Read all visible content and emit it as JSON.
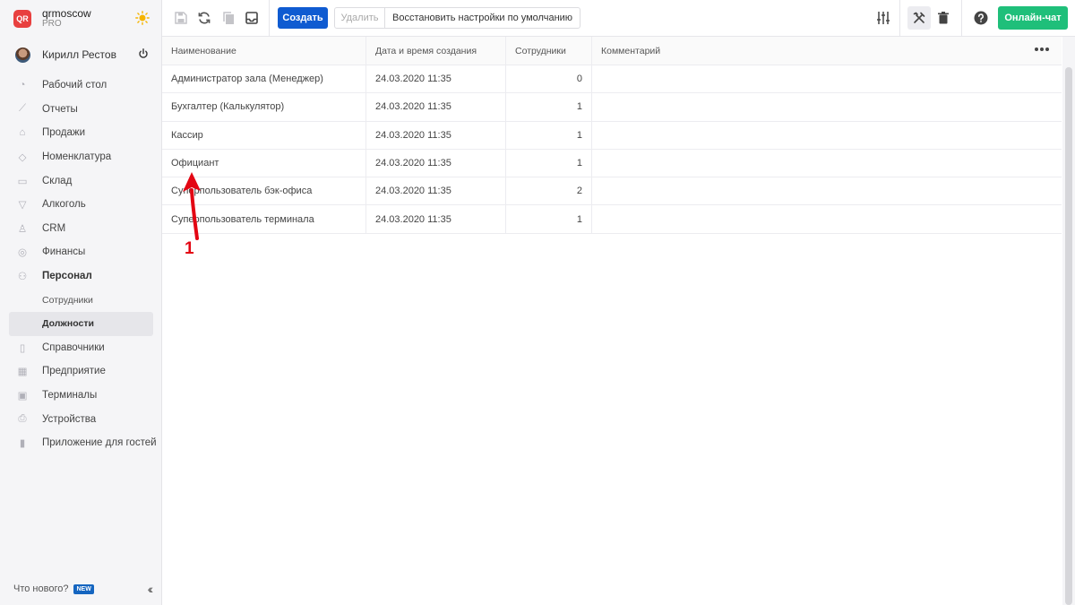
{
  "brand": {
    "logo_text": "QR",
    "name": "qrmoscow",
    "plan": "PRO"
  },
  "user": {
    "name": "Кирилл Рестов"
  },
  "nav": {
    "items": [
      {
        "label": "Рабочий стол",
        "icon": "dashboard-icon"
      },
      {
        "label": "Отчеты",
        "icon": "chart-icon"
      },
      {
        "label": "Продажи",
        "icon": "basket-icon"
      },
      {
        "label": "Номенклатура",
        "icon": "tag-icon"
      },
      {
        "label": "Склад",
        "icon": "box-icon"
      },
      {
        "label": "Алкоголь",
        "icon": "glass-icon"
      },
      {
        "label": "CRM",
        "icon": "crm-icon"
      },
      {
        "label": "Финансы",
        "icon": "coins-icon"
      },
      {
        "label": "Персонал",
        "icon": "people-icon"
      }
    ],
    "sub": [
      {
        "label": "Сотрудники"
      },
      {
        "label": "Должности"
      }
    ],
    "items2": [
      {
        "label": "Справочники",
        "icon": "book-icon"
      },
      {
        "label": "Предприятие",
        "icon": "building-icon"
      },
      {
        "label": "Терминалы",
        "icon": "terminal-icon"
      },
      {
        "label": "Устройства",
        "icon": "printer-icon"
      },
      {
        "label": "Приложение для гостей",
        "icon": "phone-icon"
      }
    ]
  },
  "footer": {
    "whats_new": "Что нового?",
    "badge": "NEW"
  },
  "toolbar": {
    "create": "Создать",
    "delete": "Удалить",
    "restore": "Восстановить настройки по умолчанию",
    "chat": "Онлайн-чат"
  },
  "table": {
    "columns": [
      "Наименование",
      "Дата и время создания",
      "Сотрудники",
      "Комментарий"
    ],
    "rows": [
      {
        "name": "Администратор зала (Менеджер)",
        "created": "24.03.2020 11:35",
        "employees": "0",
        "comment": ""
      },
      {
        "name": "Бухгалтер (Калькулятор)",
        "created": "24.03.2020 11:35",
        "employees": "1",
        "comment": ""
      },
      {
        "name": "Кассир",
        "created": "24.03.2020 11:35",
        "employees": "1",
        "comment": ""
      },
      {
        "name": "Официант",
        "created": "24.03.2020 11:35",
        "employees": "1",
        "comment": ""
      },
      {
        "name": "Суперпользователь бэк-офиса",
        "created": "24.03.2020 11:35",
        "employees": "2",
        "comment": ""
      },
      {
        "name": "Суперпользователь терминала",
        "created": "24.03.2020 11:35",
        "employees": "1",
        "comment": ""
      }
    ]
  },
  "annotation": {
    "number": "1",
    "color": "#e30613"
  }
}
